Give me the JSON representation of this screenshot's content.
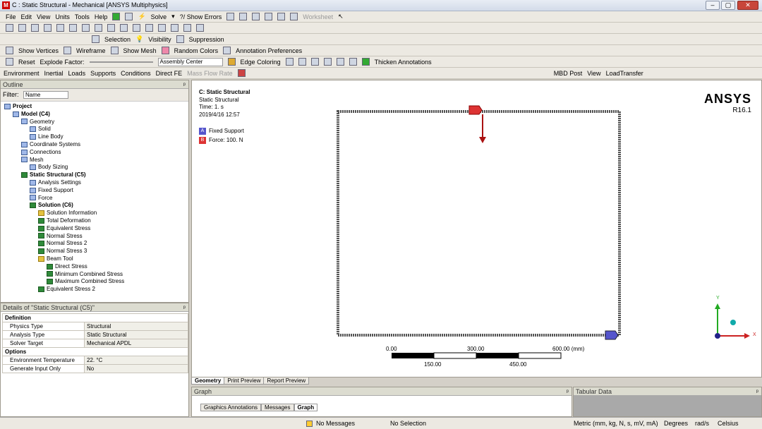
{
  "window": {
    "title": "C : Static Structural - Mechanical [ANSYS Multiphysics]",
    "logo": "M",
    "min": "–",
    "max": "▢",
    "close": "✕"
  },
  "menu": {
    "items": [
      "File",
      "Edit",
      "View",
      "Units",
      "Tools",
      "Help"
    ],
    "solve": "Solve",
    "show_errors": "?/ Show Errors",
    "worksheet": "Worksheet"
  },
  "toolbar3": {
    "selection": "Selection",
    "visibility": "Visibility",
    "suppression": "Suppression"
  },
  "toolbar4": {
    "show_vertices": "Show Vertices",
    "wireframe": "Wireframe",
    "show_mesh": "Show Mesh",
    "random_colors": "Random Colors",
    "annotation_prefs": "Annotation Preferences"
  },
  "toolbar5": {
    "reset": "Reset",
    "explode_factor": "Explode Factor:",
    "assembly_center": "Assembly Center",
    "edge_coloring": "Edge Coloring",
    "thicken_annotations": "Thicken Annotations"
  },
  "toolbar6": {
    "environment": "Environment",
    "inertial": "Inertial",
    "loads": "Loads",
    "supports": "Supports",
    "conditions": "Conditions",
    "direct_fe": "Direct FE",
    "mass_flow_rate": "Mass Flow Rate",
    "mbd_post": "MBD Post",
    "view": "View",
    "load_transfer": "LoadTransfer"
  },
  "outline": {
    "title": "Outline",
    "pin": "ᵖ",
    "filter_label": "Filter:",
    "filter_value": "Name",
    "tree": [
      {
        "label": "Project",
        "indent": 0,
        "bold": true,
        "icon": "s"
      },
      {
        "label": "Model (C4)",
        "indent": 1,
        "bold": true,
        "icon": "s"
      },
      {
        "label": "Geometry",
        "indent": 2,
        "bold": false,
        "icon": "s"
      },
      {
        "label": "Solid",
        "indent": 3,
        "bold": false,
        "icon": "s"
      },
      {
        "label": "Line Body",
        "indent": 3,
        "bold": false,
        "icon": "s"
      },
      {
        "label": "Coordinate Systems",
        "indent": 2,
        "bold": false,
        "icon": "s"
      },
      {
        "label": "Connections",
        "indent": 2,
        "bold": false,
        "icon": "s"
      },
      {
        "label": "Mesh",
        "indent": 2,
        "bold": false,
        "icon": "s"
      },
      {
        "label": "Body Sizing",
        "indent": 3,
        "bold": false,
        "icon": "s"
      },
      {
        "label": "Static Structural (C5)",
        "indent": 2,
        "bold": true,
        "icon": "g"
      },
      {
        "label": "Analysis Settings",
        "indent": 3,
        "bold": false,
        "icon": "s"
      },
      {
        "label": "Fixed Support",
        "indent": 3,
        "bold": false,
        "icon": "s"
      },
      {
        "label": "Force",
        "indent": 3,
        "bold": false,
        "icon": "s"
      },
      {
        "label": "Solution (C6)",
        "indent": 3,
        "bold": true,
        "icon": "g"
      },
      {
        "label": "Solution Information",
        "indent": 4,
        "bold": false,
        "icon": "y"
      },
      {
        "label": "Total Deformation",
        "indent": 4,
        "bold": false,
        "icon": "g"
      },
      {
        "label": "Equivalent Stress",
        "indent": 4,
        "bold": false,
        "icon": "g"
      },
      {
        "label": "Normal Stress",
        "indent": 4,
        "bold": false,
        "icon": "g"
      },
      {
        "label": "Normal Stress 2",
        "indent": 4,
        "bold": false,
        "icon": "g"
      },
      {
        "label": "Normal Stress 3",
        "indent": 4,
        "bold": false,
        "icon": "g"
      },
      {
        "label": "Beam Tool",
        "indent": 4,
        "bold": false,
        "icon": "y"
      },
      {
        "label": "Direct Stress",
        "indent": 5,
        "bold": false,
        "icon": "g"
      },
      {
        "label": "Minimum Combined Stress",
        "indent": 5,
        "bold": false,
        "icon": "g"
      },
      {
        "label": "Maximum Combined Stress",
        "indent": 5,
        "bold": false,
        "icon": "g"
      },
      {
        "label": "Equivalent Stress 2",
        "indent": 4,
        "bold": false,
        "icon": "g"
      }
    ]
  },
  "details": {
    "title": "Details of \"Static Structural (C5)\"",
    "pin": "ᵖ",
    "sections": [
      {
        "name": "Definition",
        "rows": [
          [
            "Physics Type",
            "Structural"
          ],
          [
            "Analysis Type",
            "Static Structural"
          ],
          [
            "Solver Target",
            "Mechanical APDL"
          ]
        ]
      },
      {
        "name": "Options",
        "rows": [
          [
            "Environment Temperature",
            "22. °C"
          ],
          [
            "Generate Input Only",
            "No"
          ]
        ]
      }
    ]
  },
  "viewport": {
    "header_title": "C: Static Structural",
    "header_sub": "Static Structural",
    "time": "Time: 1. s",
    "date": "2019/4/16 12:57",
    "legend": [
      {
        "key": "A",
        "label": "Fixed Support",
        "color": "#5555cc"
      },
      {
        "key": "B",
        "label": "Force: 100. N",
        "color": "#dd3333"
      }
    ],
    "brand": "ANSYS",
    "version": "R16.1",
    "scale": {
      "top": [
        "0.00",
        "300.00",
        "600.00 (mm)"
      ],
      "bottom": [
        "150.00",
        "450.00"
      ]
    },
    "triad": {
      "y": "Y",
      "x": "X"
    }
  },
  "view_tabs": [
    "Geometry",
    "Print Preview",
    "Report Preview"
  ],
  "graph": {
    "title": "Graph",
    "pin": "ᵖ",
    "tabs": [
      "Graphics Annotations",
      "Messages",
      "Graph"
    ]
  },
  "tabular": {
    "title": "Tabular Data",
    "pin": "ᵖ"
  },
  "status": {
    "messages": "No Messages",
    "selection": "No Selection",
    "units": "Metric (mm, kg, N, s, mV, mA)",
    "degrees": "Degrees",
    "rads": "rad/s",
    "celsius": "Celsius"
  }
}
